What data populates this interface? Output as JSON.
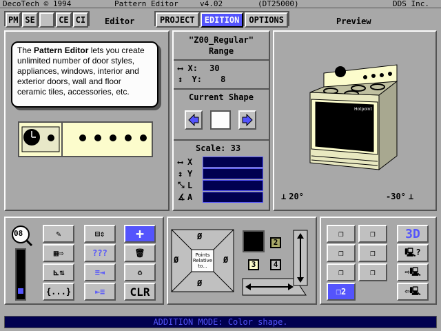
{
  "titlebar": {
    "left": "DecoTech © 1994",
    "center": "Pattern Editor",
    "version": "v4.02",
    "code": "(DT25000)",
    "right": "DDS Inc."
  },
  "toolbar": {
    "pm": "PM",
    "se": "SE",
    "ce": "CE",
    "ci": "CI"
  },
  "panels": {
    "editor": "Editor",
    "preview": "Preview"
  },
  "tabs": [
    {
      "label": "PROJECT"
    },
    {
      "label": "EDITION"
    },
    {
      "label": "OPTIONS"
    }
  ],
  "pattern": {
    "name": "\"Z00_Regular\"",
    "range": "Range",
    "x_label": "X:",
    "x_value": "30",
    "y_label": "Y:",
    "y_value": "8"
  },
  "shape": {
    "title": "Current Shape"
  },
  "scale": {
    "label": "Scale:",
    "value": "33",
    "axes": [
      "X",
      "Y",
      "L",
      "A"
    ]
  },
  "tooltip": {
    "pre": "The ",
    "bold": "Pattern Editor",
    "post": " lets you create unlimited number of door styles, appliances, windows, interior and exterior doors, wall and floor ceramic tiles, accessories, etc."
  },
  "preview": {
    "angle_left": "20°",
    "angle_right": "-30°",
    "stove_brand": "Hotpoint"
  },
  "zoom": {
    "value": "08"
  },
  "tools": {
    "help": "???",
    "braces": "{...}",
    "clr": "CLR",
    "three_d": "3D"
  },
  "points": {
    "text": "Points Relative to...",
    "empty": "Ø"
  },
  "colors_nums": {
    "n2": "2",
    "n3": "3",
    "n4": "4",
    "view": "2"
  },
  "status": {
    "text": "ADDITION MODE: Color shape."
  },
  "colors": {
    "bg": "#a8a8a8",
    "accent": "#5454fc",
    "dark_field": "#000050"
  }
}
